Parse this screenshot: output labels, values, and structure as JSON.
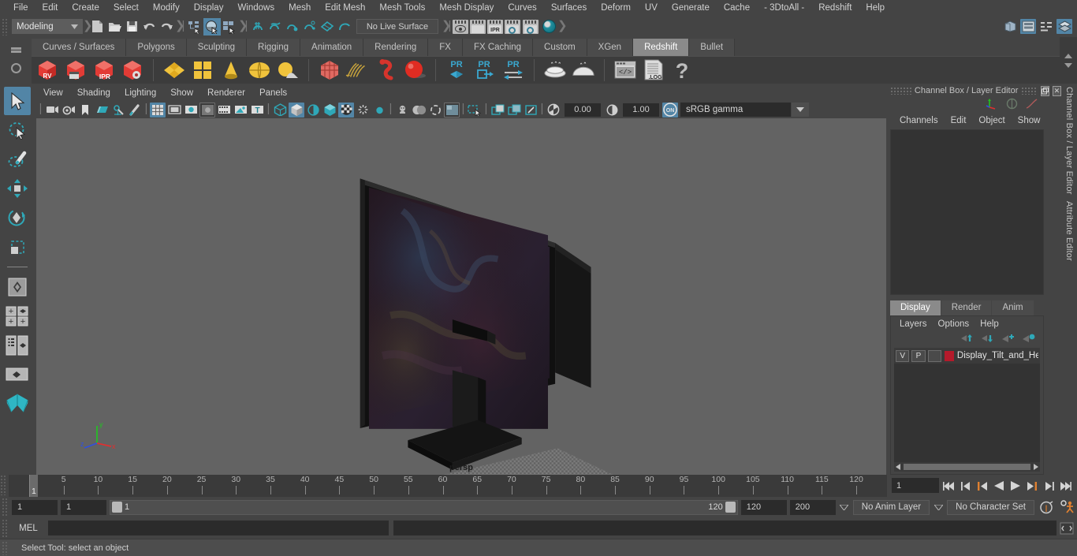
{
  "menubar": {
    "items": [
      "File",
      "Edit",
      "Create",
      "Select",
      "Modify",
      "Display",
      "Windows",
      "Mesh",
      "Edit Mesh",
      "Mesh Tools",
      "Mesh Display",
      "Curves",
      "Surfaces",
      "Deform",
      "UV",
      "Generate",
      "Cache",
      "- 3DtoAll -",
      "Redshift",
      "Help"
    ]
  },
  "statusline": {
    "menuset": "Modeling",
    "live_surface": "No Live Surface",
    "icons": [
      "new-scene-icon",
      "open-scene-icon",
      "save-scene-icon",
      "undo-icon",
      "redo-icon",
      "select-by-hierarchy-icon",
      "select-by-object-icon",
      "select-by-component-icon",
      "snap-to-grid-icon",
      "snap-to-curve-icon",
      "snap-to-point-icon",
      "snap-to-projected-center-icon",
      "snap-to-view-plane-icon",
      "make-live-icon",
      "render-view-icon",
      "render-current-frame-icon",
      "ipr-render-icon",
      "render-settings-icon",
      "hypershade-icon"
    ],
    "right_icons": [
      "sidebar-toggle-icon",
      "attribute-editor-icon",
      "tool-settings-icon",
      "channel-box-icon"
    ]
  },
  "shelf": {
    "tabs": [
      "Curves / Surfaces",
      "Polygons",
      "Sculpting",
      "Rigging",
      "Animation",
      "Rendering",
      "FX",
      "FX Caching",
      "Custom",
      "XGen",
      "Redshift",
      "Bullet"
    ],
    "active_tab": "Redshift",
    "buttons": [
      "redshift-rv-icon",
      "redshift-render-sequence-icon",
      "redshift-ipr-icon",
      "redshift-render-settings-icon",
      "poly-plane-icon",
      "poly-cube-icon",
      "poly-cone-icon",
      "poly-sphere-icon",
      "poly-sun-icon",
      "redshift-proxy-icon",
      "redshift-hair-icon",
      "redshift-volume-icon",
      "redshift-sphere-icon",
      "redshift-pr-object-icon",
      "redshift-pr-export-icon",
      "redshift-pr-toggle-icon",
      "redshift-bake-icon",
      "redshift-bake-set-icon",
      "redshift-script-icon",
      "redshift-log-icon",
      "redshift-help-icon"
    ]
  },
  "toolbox": {
    "tools": [
      "select-tool",
      "lasso-select-tool",
      "paint-select-tool",
      "move-tool",
      "rotate-tool",
      "scale-tool",
      "last-tool-used",
      "layout-single-icon",
      "layout-two-panes-icon",
      "layout-outliner-persp-icon",
      "layout-persp-icon",
      "maya-logo-icon"
    ]
  },
  "viewport": {
    "menus": [
      "View",
      "Shading",
      "Lighting",
      "Show",
      "Renderer",
      "Panels"
    ],
    "camera_label": "persp",
    "exposure": "0.00",
    "gamma": "1.00",
    "color_profile": "sRGB gamma",
    "axis": {
      "x": "x",
      "y": "y",
      "z": "z"
    },
    "toolbar_icons": [
      "select-camera-icon",
      "camera-attributes-icon",
      "bookmark-icon",
      "image-plane-icon",
      "2d-pan-zoom-icon",
      "grease-pencil-icon",
      "grid-toggle-icon",
      "film-gate-icon",
      "resolution-gate-icon",
      "gate-mask-icon",
      "film-origin-icon",
      "safe-action-icon",
      "text-toggle-icon",
      "wireframe-icon",
      "smooth-shade-icon",
      "shaded-wireframe-icon",
      "use-default-material-icon",
      "xray-icon",
      "xray-joints-icon",
      "lighting-icon",
      "shadows-icon",
      "screen-space-ao-icon",
      "motion-blur-icon",
      "multisample-icon",
      "isolate-select-icon",
      "snapshot-icon",
      "render-region-icon",
      "image-region-icon",
      "exposure-icon",
      "gamma-icon",
      "color-management-icon"
    ]
  },
  "dock": {
    "title": "Channel Box / Layer Editor",
    "side_labels": [
      "Channel Box / Layer Editor",
      "Attribute Editor"
    ],
    "channel_menus": [
      "Channels",
      "Edit",
      "Object",
      "Show"
    ],
    "layer_tabs": [
      "Display",
      "Render",
      "Anim"
    ],
    "active_layer_tab": "Display",
    "layer_menus": [
      "Layers",
      "Options",
      "Help"
    ],
    "layers": [
      {
        "visible": "V",
        "playback": "P",
        "type": "",
        "color": "#b51a2b",
        "name": "Display_Tilt_and_Heigh"
      }
    ]
  },
  "timeline": {
    "ticks": [
      5,
      10,
      15,
      20,
      25,
      30,
      35,
      40,
      45,
      50,
      55,
      60,
      65,
      70,
      75,
      80,
      85,
      90,
      95,
      100,
      105,
      110,
      115,
      120
    ],
    "current_frame_marker": "1",
    "current_frame_field": "1",
    "playback_buttons": [
      "go-to-start-icon",
      "step-back-keyframe-icon",
      "step-back-frame-icon",
      "play-backwards-icon",
      "play-forwards-icon",
      "step-forward-frame-icon",
      "step-forward-keyframe-icon",
      "go-to-end-icon"
    ]
  },
  "range": {
    "start": "1",
    "range_start": "1",
    "slider_left_value": "1",
    "slider_right_value": "120",
    "range_end": "120",
    "end": "200",
    "anim_layer": "No Anim Layer",
    "character_set": "No Character Set",
    "right_icons": [
      "auto-keyframe-icon",
      "animation-preferences-icon"
    ]
  },
  "command": {
    "label": "MEL",
    "input_value": "",
    "output_value": "",
    "script-editor-icon": "script-editor-icon"
  },
  "help": {
    "text": "Select Tool: select an object"
  },
  "colors": {
    "accent": "#5285a6",
    "shelf_active": "#8a8a8a",
    "teal": "#2fa8b8",
    "layer_color": "#b51a2b",
    "panel_bg": "#444444",
    "viewport_bg": "#636363"
  }
}
